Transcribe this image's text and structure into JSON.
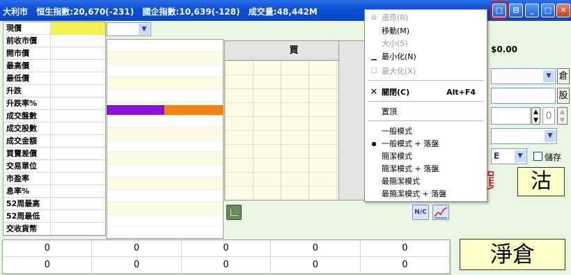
{
  "titlebar": {
    "app": "大利市",
    "hsi": "恒生指數:20,670(-231)",
    "hscei": "國企指數:10,639(-128)",
    "turnover": "成交量:48,442M",
    "buttons": [
      "□",
      "⊟",
      "_",
      "□",
      "✕"
    ]
  },
  "quote_labels": [
    "現價",
    "前收市價",
    "開市價",
    "最高價",
    "最低價",
    "升跌",
    "升跌率%",
    "成交盤數",
    "成交股數",
    "成交金額",
    "買賣差價",
    "交易單位",
    "市盈率",
    "息率%",
    "52周最高",
    "52周最低",
    "交收貨幣"
  ],
  "buy_header": "買",
  "price_display": "$0.00",
  "right_buttons": {
    "warehouse": "倉",
    "shares": "股",
    "qty_value": "0",
    "mode_value": "E",
    "save_label": "儲存",
    "buy_btn": "買",
    "sell_btn": "沽"
  },
  "nc_label": "N/C",
  "bottom_rows": [
    [
      "0",
      "0",
      "0",
      "0",
      "0"
    ],
    [
      "0",
      "0",
      "0",
      "0",
      "0"
    ]
  ],
  "net_button": "淨倉",
  "menu": {
    "restore": "還原(R)",
    "move": "移動(M)",
    "size": "大小(S)",
    "minimize": "最小化(N)",
    "maximize": "最大化(X)",
    "close": "關閉(C)",
    "close_shortcut": "Alt+F4",
    "ontop": "置頂",
    "mode_normal": "一般模式",
    "mode_normal_book": "一般模式 + 落盤",
    "mode_simple": "簡潔模式",
    "mode_simple_book": "簡潔模式 + 落盤",
    "mode_simplest": "最簡潔模式",
    "mode_simplest_book": "最簡潔模式 + 落盤"
  },
  "colors": {
    "highlight_yellow": "#f4f050",
    "bar_purple": "#8c10e0",
    "bar_orange": "#f88010",
    "title_blue": "#0b4fd6"
  }
}
